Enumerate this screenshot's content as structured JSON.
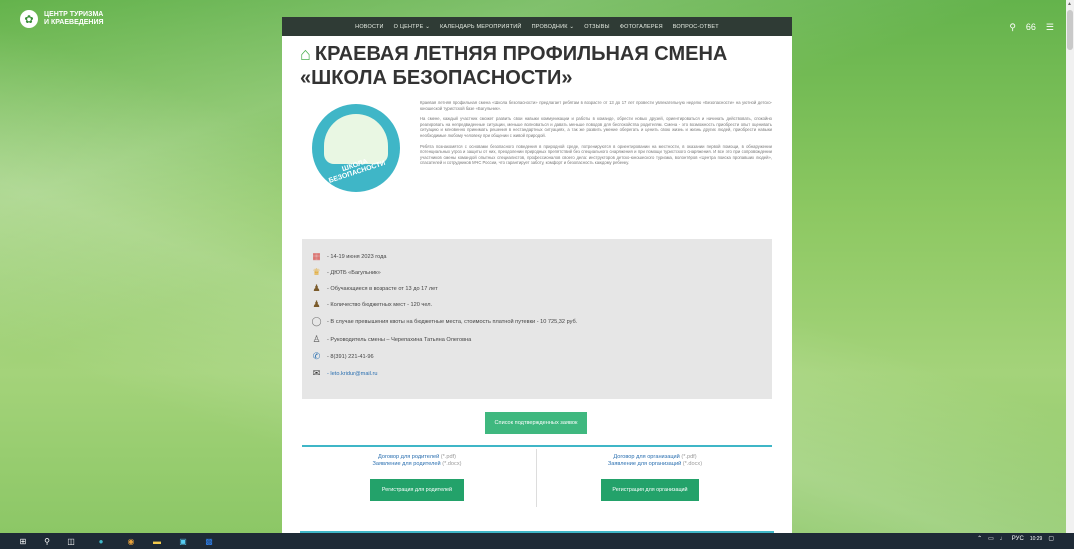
{
  "logo": {
    "line1": "ЦЕНТР ТУРИЗМА",
    "line2": "И КРАЕВЕДЕНИЯ"
  },
  "nav": [
    "НОВОСТИ",
    "О ЦЕНТРЕ ⌄",
    "КАЛЕНДАРЬ МЕРОПРИЯТИЙ",
    "ПРОВОДНИК ⌄",
    "ОТЗЫВЫ",
    "ФОТОГАЛЕРЕЯ",
    "ВОПРОС-ОТВЕТ"
  ],
  "header_right": {
    "search_icon": "search-icon",
    "counter": "66",
    "menu_icon": "menu-icon"
  },
  "page": {
    "title": "КРАЕВАЯ ЛЕТНЯЯ ПРОФИЛЬНАЯ СМЕНА «ШКОЛА БЕЗОПАСНОСТИ»",
    "emblem_text": "ШКОЛА БЕЗОПАСНОСТИ",
    "paragraphs": [
      "Краевая летняя профильная смена «Школа безопасности» предлагает ребятам в возрасте от 13 до 17 лет провести увлекательную неделю «Безопасности» на уютной детско-юношеской туристской базе «Багульник».",
      "На смене, каждый участник сможет развить свои навыки коммуникации и работы в команде, обрести новых друзей, ориентироваться и начинать действовать, спокойно реагировать на непредвиденные ситуации, меньше волноваться и давать меньше поводов для беспокойства родителям. Смена - это возможность приобрести опыт оценивать ситуацию и мгновенно принимать решения в нестандартных ситуациях, а так же развить умение оберегать и ценить свою жизнь и жизнь других людей, приобрести навыки необходимые любому человеку при общении с живой природой.",
      "Ребята познакомятся с основами безопасного поведения в природной среде, потренируются в ориентировании на местности, в оказании первой помощи, в обнаружении потенциальных угроз и защиты от них, преодолении природных препятствий без специального снаряжения и при помощи туристского снаряжения. И все это при сопровождении участников смены командой опытных специалистов, профессионалов своего дела: инструкторов детско-юношеского туризма, волонтёров «Центра поиска пропавших людей», спасателей и сотрудников МЧС России, что гарантирует заботу, комфорт и безопасность каждому ребенку."
    ]
  },
  "info": [
    {
      "icon": "calendar-icon",
      "text": "- 14-19 июня 2023 года"
    },
    {
      "icon": "trophy-icon",
      "text": "- ДЮТБ «Багульник»"
    },
    {
      "icon": "group-icon",
      "text": "- Обучающиеся в возрасте от 13 до 17 лет"
    },
    {
      "icon": "group-icon",
      "text": "- Количество бюджетных мест - 120 чел."
    },
    {
      "icon": "coins-icon",
      "text": "- В случае превышения квоты на бюджетные места, стоимость платной путевки - 10 725,32 руб."
    },
    {
      "icon": "person-icon",
      "text": "- Руководитель смены – Черепахина Татьяна Олеговна"
    },
    {
      "icon": "phone-icon",
      "text": "- 8(391) 221-41-96"
    },
    {
      "icon": "email-icon",
      "text": "- leto.kridur@mail.ru"
    }
  ],
  "buttons": {
    "applications": "Список подтвержденных заявок",
    "reg_parents": "Регистрация для родителей",
    "reg_orgs": "Регистрация для организаций"
  },
  "docs": {
    "parents": [
      {
        "label": "Договор для родителей",
        "ext": "(*.pdf)"
      },
      {
        "label": "Заявление для родителей",
        "ext": "(*.docx)"
      }
    ],
    "orgs": [
      {
        "label": "Договор для организаций",
        "ext": "(*.pdf)"
      },
      {
        "label": "Заявление для организаций",
        "ext": "(*.docx)"
      }
    ]
  },
  "taskbar": {
    "lang": "РУС",
    "time": "10:29",
    "icons": [
      "windows-icon",
      "search-icon",
      "task-view-icon",
      "browser-icon",
      "chrome-icon",
      "file-explorer-icon",
      "photos-icon",
      "app-icon"
    ]
  }
}
